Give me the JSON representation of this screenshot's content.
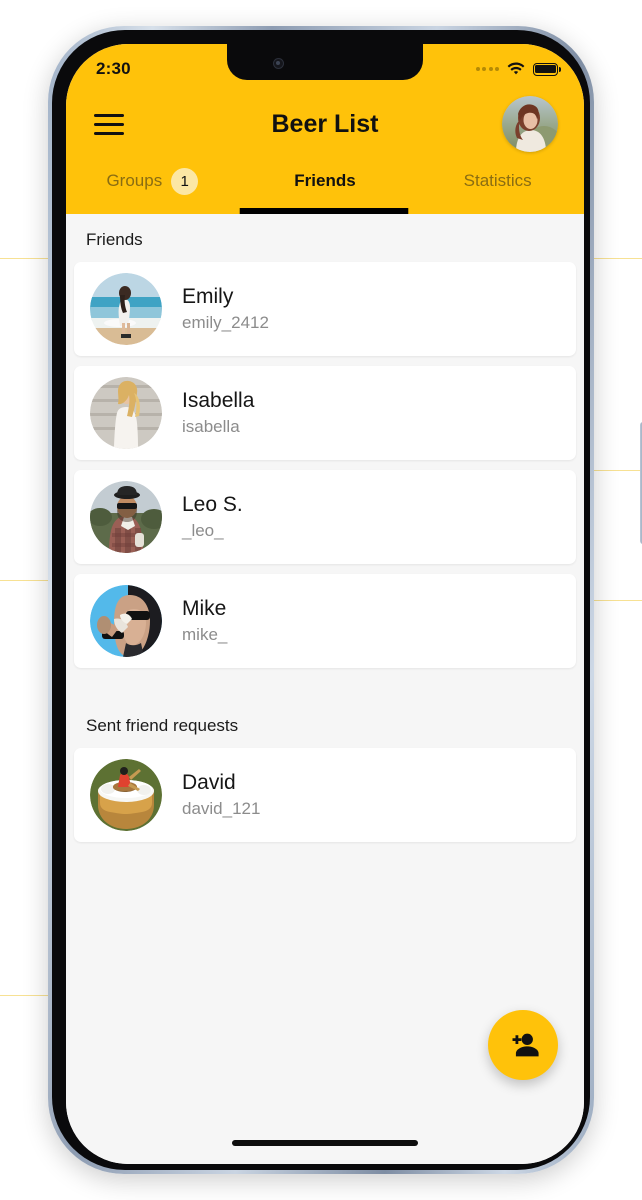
{
  "status_bar": {
    "time": "2:30",
    "signal_icon": "signal-dots-icon",
    "wifi_icon": "wifi-icon",
    "battery_icon": "battery-full-icon"
  },
  "header": {
    "menu_icon": "hamburger-menu-icon",
    "title": "Beer List",
    "avatar_icon": "user-avatar"
  },
  "tabs": [
    {
      "label": "Groups",
      "badge": "1",
      "active": false
    },
    {
      "label": "Friends",
      "badge": "",
      "active": true
    },
    {
      "label": "Statistics",
      "badge": "",
      "active": false
    }
  ],
  "sections": [
    {
      "title": "Friends",
      "items": [
        {
          "name": "Emily",
          "handle": "emily_2412",
          "avatar": "beach-woman-photo"
        },
        {
          "name": "Isabella",
          "handle": "isabella",
          "avatar": "blonde-woman-photo"
        },
        {
          "name": "Leo S.",
          "handle": "_leo_",
          "avatar": "man-with-hat-photo"
        },
        {
          "name": "Mike",
          "handle": "mike_",
          "avatar": "man-drinking-photo"
        }
      ]
    },
    {
      "title": "Sent friend requests",
      "items": [
        {
          "name": "David",
          "handle": "david_121",
          "avatar": "beer-rowing-photo"
        }
      ]
    }
  ],
  "fab": {
    "icon": "add-person-icon",
    "label": "Add friend"
  },
  "colors": {
    "brand_yellow": "#FFC20A",
    "badge_yellow": "#FCE7A4",
    "tab_inactive": "#8A6D12",
    "card_background": "#FFFFFF",
    "page_background": "#F6F6F6"
  }
}
